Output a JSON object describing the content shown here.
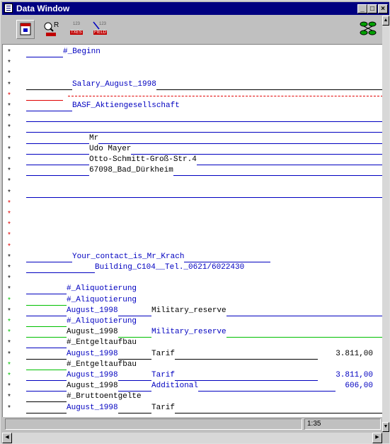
{
  "window": {
    "title": "Data Window"
  },
  "toolbar": {
    "tools": [
      {
        "name": "calendar-tool",
        "icon": "calendar-icon"
      },
      {
        "name": "zoom-tool",
        "icon": "magnifier-icon",
        "label": "R"
      },
      {
        "name": "text-field-tool",
        "icon": "text-field-icon",
        "label": "123",
        "sublabel": "TXES"
      },
      {
        "name": "field-tool",
        "icon": "field-icon",
        "label": "123",
        "sublabel": "FIELD"
      }
    ],
    "right_icon": "network-icon"
  },
  "content": {
    "lines": [
      {
        "mark": "*",
        "mark_color": "black",
        "text": "#_Beginn",
        "text_color": "blue",
        "indent": 85,
        "line_color": "blue",
        "line_to": 85
      },
      {
        "mark": "*",
        "mark_color": "black"
      },
      {
        "mark": "*",
        "mark_color": "black"
      },
      {
        "mark": "*",
        "mark_color": "black",
        "text": "Salary_August_1998",
        "text_color": "blue",
        "indent": 98,
        "line_color": "black",
        "line_to": 537
      },
      {
        "mark": "*",
        "mark_color": "red",
        "dashed": true
      },
      {
        "mark": "*",
        "mark_color": "black",
        "text": "BASF_Aktiengesellschaft",
        "text_color": "blue",
        "indent": 98,
        "line_color": "blue",
        "line_to": 98
      },
      {
        "mark": "*",
        "mark_color": "black",
        "line_color": "blue",
        "line_to": 537,
        "line_from": 33
      },
      {
        "mark": "*",
        "mark_color": "black",
        "line_color": "blue",
        "line_to": 537,
        "line_from": 33
      },
      {
        "mark": "*",
        "mark_color": "black",
        "text": "Mr",
        "text_color": "black",
        "indent": 122,
        "line_color": "blue",
        "line_to": 537
      },
      {
        "mark": "*",
        "mark_color": "black",
        "text": "Udo Mayer",
        "text_color": "black",
        "indent": 122,
        "line_color": "blue",
        "line_to": 537
      },
      {
        "mark": "*",
        "mark_color": "black",
        "text": "Otto-Schmitt-Groß-Str.4",
        "text_color": "black",
        "indent": 122,
        "line_color": "blue",
        "line_to": 537
      },
      {
        "mark": "*",
        "mark_color": "black",
        "text": "67098_Bad_Dürkheim",
        "text_color": "black",
        "indent": 122,
        "line_color": "blue",
        "line_to": 537
      },
      {
        "mark": "*",
        "mark_color": "black"
      },
      {
        "mark": "*",
        "mark_color": "black",
        "line_color": "blue",
        "line_to": 537,
        "line_from": 33
      },
      {
        "mark": "*",
        "mark_color": "red"
      },
      {
        "mark": "*",
        "mark_color": "red"
      },
      {
        "mark": "*",
        "mark_color": "red"
      },
      {
        "mark": "*",
        "mark_color": "red"
      },
      {
        "mark": "*",
        "mark_color": "red"
      },
      {
        "mark": "*",
        "mark_color": "black",
        "text": "Your_contact_is_Mr_Krach",
        "text_color": "blue",
        "indent": 98,
        "line_color": "blue",
        "line_to": 378
      },
      {
        "mark": "*",
        "mark_color": "black",
        "text": "Building_C104__Tel._0621/6022430",
        "text_color": "blue",
        "indent": 130,
        "line_color": "blue",
        "line_to": 130
      },
      {
        "mark": "*",
        "mark_color": "black"
      },
      {
        "mark": "*",
        "mark_color": "black",
        "text": "#_Aliquotierung",
        "text_color": "blue",
        "indent": 90,
        "line_color": "blue",
        "line_to": 90
      },
      {
        "mark": "*",
        "mark_color": "green",
        "text": "#_Aliquotierung",
        "text_color": "blue",
        "indent": 90,
        "line_color": "green",
        "line_to": 90
      },
      {
        "mark": "*",
        "mark_color": "black",
        "text": "August_1998",
        "text_color": "blue",
        "indent": 90,
        "line_color": "blue",
        "line_to": 537,
        "text2": "Military_reserve",
        "text2_color": "black",
        "text2_x": 210
      },
      {
        "mark": "*",
        "mark_color": "green",
        "text": "#_Aliquotierung",
        "text_color": "blue",
        "indent": 90,
        "line_color": "green",
        "line_to": 90
      },
      {
        "mark": "*",
        "mark_color": "green",
        "text": "August_1998",
        "text_color": "green",
        "indent": 90,
        "line_color": "green",
        "line_to": 537,
        "text2": "Military_reserve",
        "text2_color": "blue",
        "text2_x": 210
      },
      {
        "mark": "*",
        "mark_color": "black",
        "text": "#_Entgeltaufbau",
        "text_color": "black",
        "indent": 90,
        "line_color": "blue",
        "line_to": 90
      },
      {
        "mark": "*",
        "mark_color": "black",
        "text": "August_1998",
        "text_color": "blue",
        "indent": 90,
        "line_color": "black",
        "line_to": 445,
        "text2": "Tarif",
        "text2_color": "black",
        "text2_x": 210,
        "value": "3.811,00",
        "value_color": "black"
      },
      {
        "mark": "*",
        "mark_color": "green",
        "text": "#_Entgeltaufbau",
        "text_color": "green",
        "indent": 90,
        "line_color": "green",
        "line_to": 90
      },
      {
        "mark": "*",
        "mark_color": "green",
        "text": "August_1998",
        "text_color": "blue",
        "indent": 90,
        "line_color": "blue",
        "line_to": 445,
        "text2": "Tarif",
        "text2_color": "blue",
        "text2_x": 210,
        "value": "3.811,00",
        "value_color": "blue"
      },
      {
        "mark": "*",
        "mark_color": "black",
        "text": "August_1998",
        "text_color": "black",
        "indent": 90,
        "line_color": "blue",
        "line_to": 470,
        "text2": "Additional",
        "text2_color": "blue",
        "text2_x": 210,
        "value": "606,00",
        "value_color": "blue"
      },
      {
        "mark": "*",
        "mark_color": "black",
        "text": "#_Bruttoentgelte",
        "text_color": "black",
        "indent": 90,
        "line_color": "black",
        "line_to": 90
      },
      {
        "mark": "*",
        "mark_color": "black",
        "text": "August_1998",
        "text_color": "blue",
        "indent": 90,
        "line_color": "black",
        "line_to": 537,
        "text2": "Tarif",
        "text2_color": "black",
        "text2_x": 210
      }
    ]
  },
  "statusbar": {
    "position": "1:35"
  }
}
